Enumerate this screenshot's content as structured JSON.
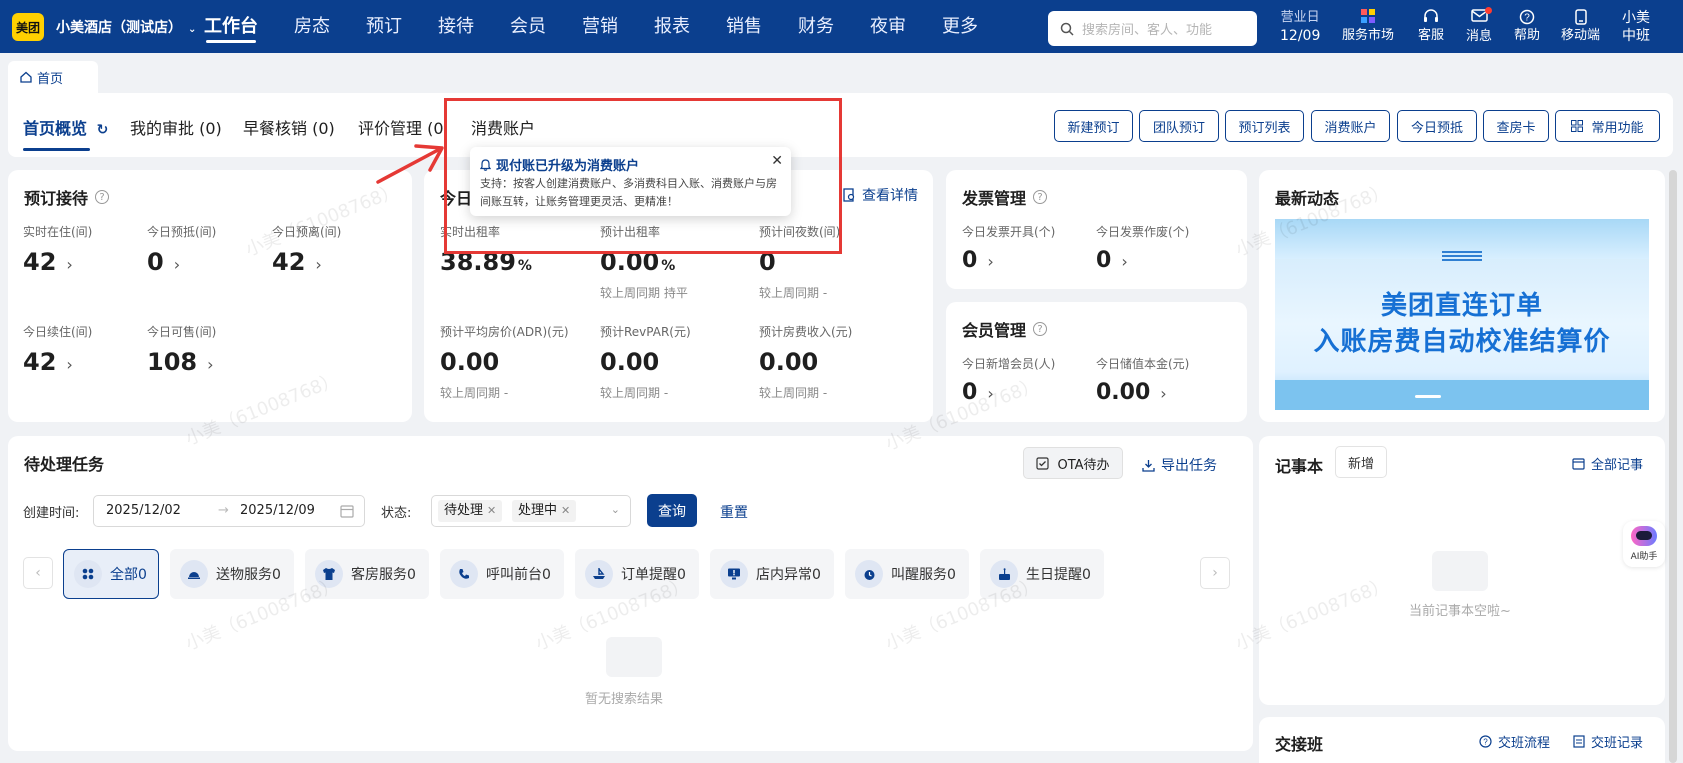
{
  "topbar": {
    "logo": "美团",
    "store_name": "小美酒店（测试店）",
    "nav": [
      "工作台",
      "房态",
      "预订",
      "接待",
      "会员",
      "营销",
      "报表",
      "销售",
      "财务",
      "夜审",
      "更多"
    ],
    "search_placeholder": "搜索房间、客人、功能",
    "business_day_label": "营业日",
    "business_day": "12/09",
    "tools": [
      "服务市场",
      "客服",
      "消息",
      "帮助",
      "移动端"
    ],
    "user_name": "小美",
    "user_shift": "中班"
  },
  "tabs": {
    "home": "首页"
  },
  "subtabs": [
    "首页概览",
    "我的审批 (0)",
    "早餐核销 (0)",
    "评价管理 (0",
    "消费账户"
  ],
  "quick_buttons": [
    "新建预订",
    "团队预订",
    "预订列表",
    "消费账户",
    "今日预抵",
    "查房卡",
    "常用功能"
  ],
  "popover": {
    "title": "现付账已升级为消费账户",
    "desc": "支持：按客人创建消费账户、多消费科目入账、消费账户与房间账互转，让账务管理更灵活、更精准！"
  },
  "reservation": {
    "title": "预订接待",
    "stats": [
      {
        "label": "实时在住(间)",
        "value": "42"
      },
      {
        "label": "今日预抵(间)",
        "value": "0"
      },
      {
        "label": "今日预离(间)",
        "value": "42"
      },
      {
        "label": "今日续住(间)",
        "value": "42"
      },
      {
        "label": "今日可售(间)",
        "value": "108"
      }
    ]
  },
  "today": {
    "title": "今日",
    "detail_link": "查看详情",
    "stats": [
      {
        "label": "实时出租率",
        "value": "38.89",
        "unit": "%",
        "cmp": ""
      },
      {
        "label": "预计出租率",
        "value": "0.00",
        "unit": "%",
        "cmp": "较上周同期  持平"
      },
      {
        "label": "预计间夜数(间)",
        "value": "0",
        "unit": "",
        "cmp": "较上周同期  -"
      },
      {
        "label": "预计平均房价(ADR)(元)",
        "value": "0.00",
        "unit": "",
        "cmp": "较上周同期  -"
      },
      {
        "label": "预计RevPAR(元)",
        "value": "0.00",
        "unit": "",
        "cmp": "较上周同期  -"
      },
      {
        "label": "预计房费收入(元)",
        "value": "0.00",
        "unit": "",
        "cmp": "较上周同期  -"
      }
    ]
  },
  "invoice": {
    "title": "发票管理",
    "stats": [
      {
        "label": "今日发票开具(个)",
        "value": "0"
      },
      {
        "label": "今日发票作废(个)",
        "value": "0"
      }
    ]
  },
  "member": {
    "title": "会员管理",
    "stats": [
      {
        "label": "今日新增会员(人)",
        "value": "0"
      },
      {
        "label": "今日储值本金(元)",
        "value": "0.00"
      }
    ]
  },
  "news": {
    "title": "最新动态",
    "banner_line1": "美团直连订单",
    "banner_line2": "入账房费自动校准结算价"
  },
  "tasks": {
    "title": "待处理任务",
    "ota_button": "OTA待办",
    "export_link": "导出任务",
    "created_label": "创建时间:",
    "date_from": "2025/12/02",
    "date_to": "2025/12/09",
    "status_label": "状态:",
    "status_tags": [
      "待处理",
      "处理中"
    ],
    "query_button": "查询",
    "reset_button": "重置",
    "categories": [
      "全部0",
      "送物服务0",
      "客房服务0",
      "呼叫前台0",
      "订单提醒0",
      "店内异常0",
      "叫醒服务0",
      "生日提醒0"
    ],
    "empty_text": "暂无搜索结果"
  },
  "notes": {
    "title": "记事本",
    "add_button": "新增",
    "all_link": "全部记事",
    "empty_text": "当前记事本空啦~"
  },
  "handover": {
    "title": "交接班",
    "flow_link": "交班流程",
    "record_link": "交班记录"
  },
  "ai_assistant": "AI助手",
  "watermark": "小美（61008768）",
  "colors": {
    "brand": "#0b3f8e",
    "logo": "#ffd000",
    "alert": "#e53935"
  }
}
